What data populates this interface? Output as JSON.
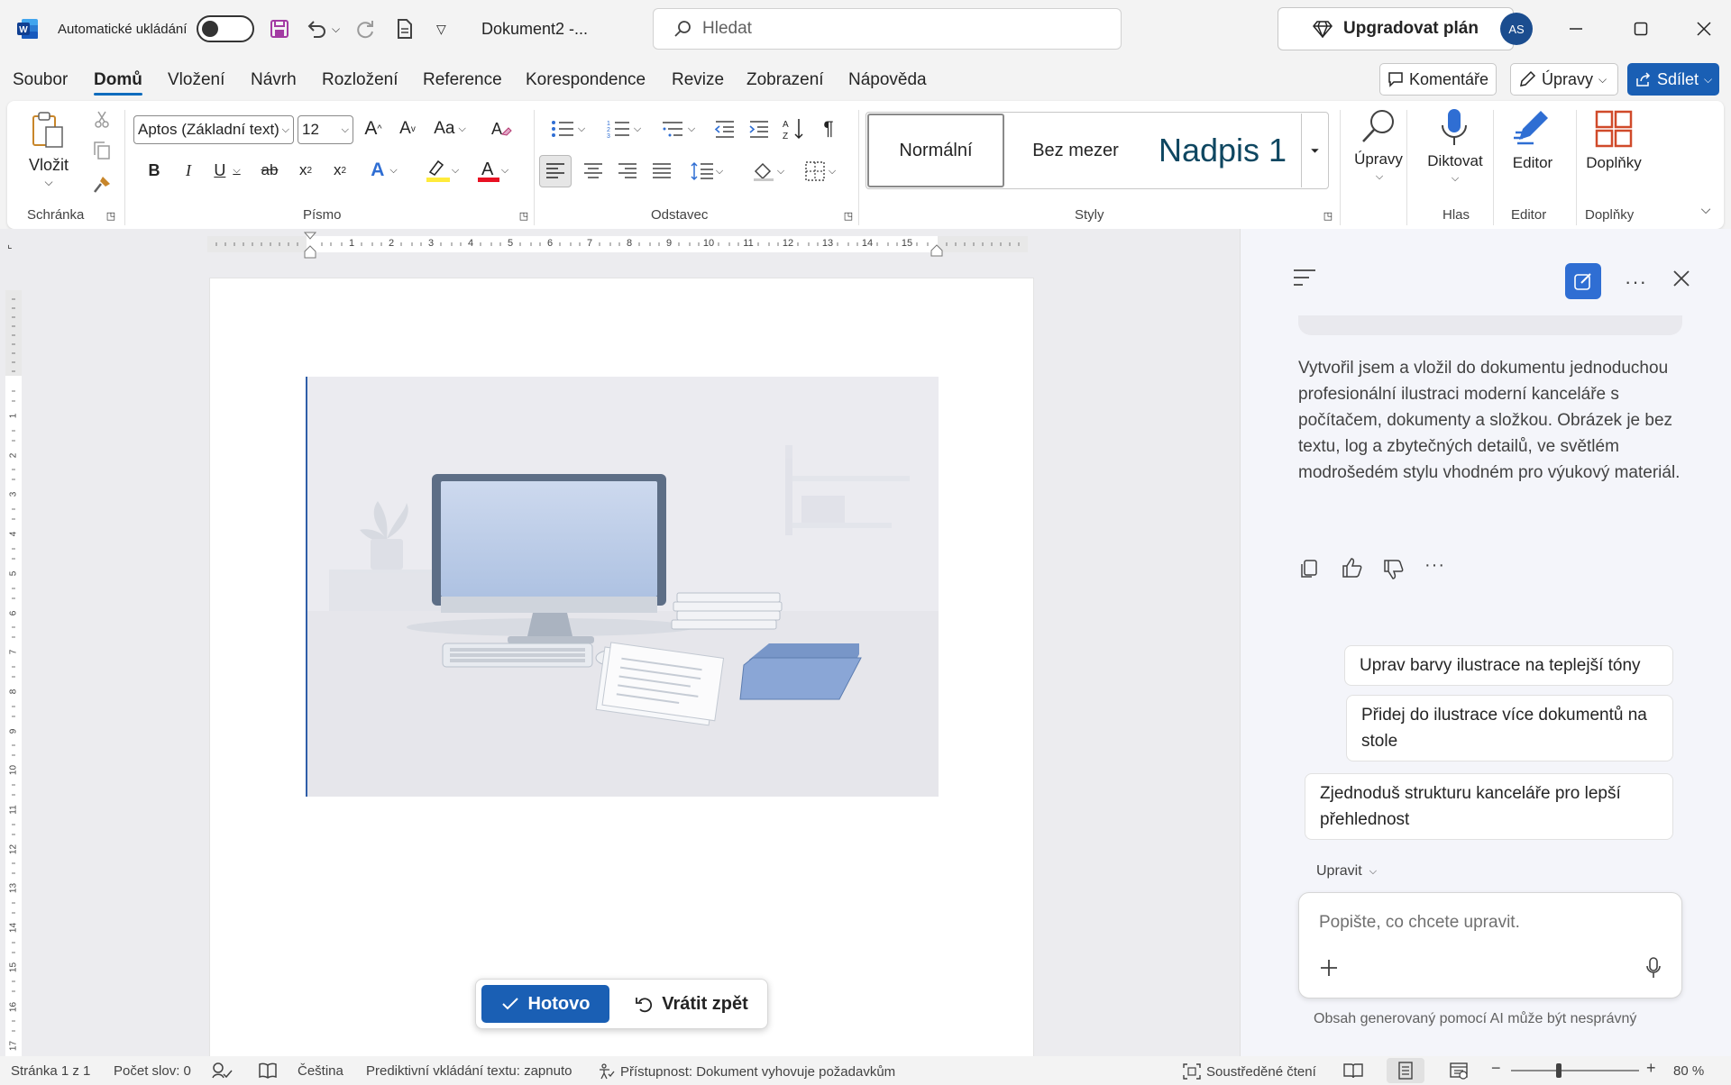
{
  "titlebar": {
    "autosave_label": "Automatické ukládání",
    "doc_title": "Dokument2  -...",
    "search_placeholder": "Hledat",
    "upgrade_label": "Upgradovat plán",
    "avatar_initials": "AS"
  },
  "menu": {
    "tabs": [
      "Soubor",
      "Domů",
      "Vložení",
      "Návrh",
      "Rozložení",
      "Reference",
      "Korespondence",
      "Revize",
      "Zobrazení",
      "Nápověda"
    ],
    "active_tab": "Domů",
    "comments_label": "Komentáře",
    "edit_label": "Úpravy",
    "share_label": "Sdílet"
  },
  "ribbon": {
    "paste_label": "Vložit",
    "font_name": "Aptos (Základní text)",
    "font_size": "12",
    "groups": {
      "clipboard": "Schránka",
      "font": "Písmo",
      "paragraph": "Odstavec",
      "styles": "Styly",
      "voice": "Hlas",
      "editor": "Editor",
      "addins": "Doplňky"
    },
    "styles": [
      "Normální",
      "Bez mezer",
      "Nadpis 1"
    ],
    "editing_label": "Úpravy",
    "dictate_label": "Diktovat",
    "editor_label": "Editor",
    "addins_label": "Doplňky"
  },
  "ruler": {
    "h_numbers": [
      "1",
      "2",
      "3",
      "4",
      "5",
      "6",
      "7",
      "8",
      "9",
      "10",
      "11",
      "12",
      "13",
      "14",
      "15"
    ],
    "v_numbers": [
      "1",
      "2",
      "3",
      "4",
      "5",
      "6",
      "7",
      "8",
      "9",
      "10",
      "11",
      "12",
      "13",
      "14",
      "15",
      "16",
      "17"
    ]
  },
  "doc_actions": {
    "done_label": "Hotovo",
    "undo_label": "Vrátit zpět"
  },
  "copilot": {
    "message": "Vytvořil jsem a vložil do dokumentu jednoduchou profesionální ilustraci moderní kanceláře s počítačem, dokumenty a složkou. Obrázek je bez textu, log a zbytečných detailů, ve světlém modrošedém stylu vhodném pro výukový materiál.",
    "suggestions": [
      "Uprav barvy ilustrace na teplejší tóny",
      "Přidej do ilustrace více dokumentů na stole",
      "Zjednoduš strukturu kanceláře pro lepší přehlednost"
    ],
    "mode_label": "Upravit",
    "input_placeholder": "Popište, co chcete upravit.",
    "disclaimer": "Obsah generovaný pomocí AI může být nesprávný"
  },
  "status": {
    "page": "Stránka 1 z 1",
    "words": "Počet slov: 0",
    "language": "Čeština",
    "predictive": "Prediktivní vkládání textu: zapnuto",
    "accessibility": "Přístupnost: Dokument vyhovuje požadavkům",
    "focus": "Soustředěné čtení",
    "zoom": "80 %"
  },
  "colors": {
    "accent": "#1a5fb4",
    "word_blue": "#185abd",
    "ribbon_bg": "#ffffff",
    "panel_bg": "#f4f5fa"
  }
}
